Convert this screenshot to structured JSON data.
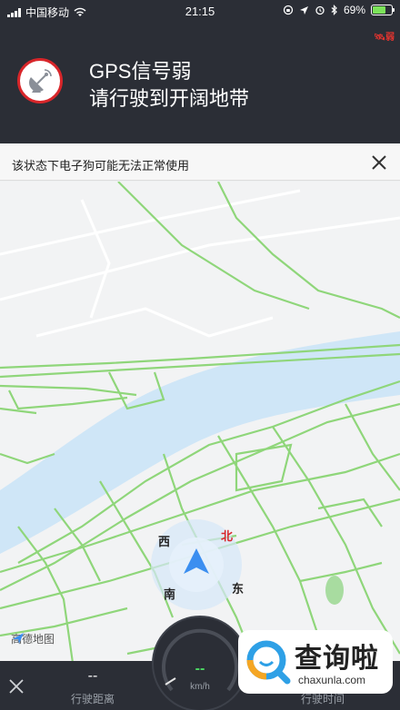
{
  "status_bar": {
    "carrier": "中国移动",
    "time": "21:15",
    "battery": "69%",
    "battery_level": 0.69
  },
  "gps_alert": {
    "badge": "弱",
    "title": "GPS信号弱",
    "subtitle": "请行驶到开阔地带",
    "icon": "satellite-dish-icon"
  },
  "warning_banner": {
    "text": "该状态下电子狗可能无法正常使用",
    "close_icon": "close-icon"
  },
  "map": {
    "compass": {
      "north": "北",
      "south": "南",
      "east": "东",
      "west": "西"
    },
    "logo": "高德地图",
    "colors": {
      "road": "#8fd67a",
      "river": "#cfe6f7",
      "background": "#f2f3f4",
      "arrow": "#3b8ef0"
    }
  },
  "bottom_bar": {
    "exit_icon": "close-icon",
    "distance_value": "--",
    "distance_label": "行驶距离",
    "speed_value": "--",
    "speed_unit": "km/h",
    "time_value": "--",
    "time_label": "行驶时间"
  },
  "watermark": {
    "title": "查询啦",
    "url": "chaxunla.com"
  }
}
